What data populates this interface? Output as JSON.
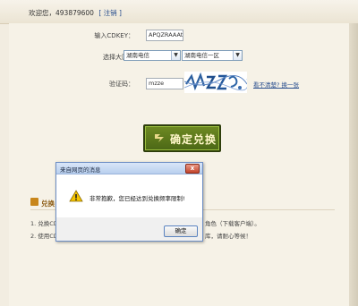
{
  "header": {
    "welcome": "欢迎您，493879600",
    "logout": "[ 注销 ]"
  },
  "form": {
    "cdkey_label": "输入CDKEY：",
    "cdkey_value": "APQZRAAAtXLhAKhA",
    "region_label": "选择大区：",
    "region_value": "湖南电信",
    "server_value": "湖南电信一区",
    "code_label": "验证码：",
    "code_value": "mzze",
    "captcha_link": "看不清楚? 换一张",
    "confirm_label": "确定兑换"
  },
  "section": {
    "title": "兑换",
    "notes": [
      "1. 兑换CD",
      "角色（下载客户端）。",
      "2. 使用CD",
      "库，请耐心等候！"
    ]
  },
  "dialog": {
    "title": "来自网页的消息",
    "message": "非常抱歉，您已经达到兑换频率限制!",
    "ok_label": "确定",
    "close_glyph": "x"
  }
}
